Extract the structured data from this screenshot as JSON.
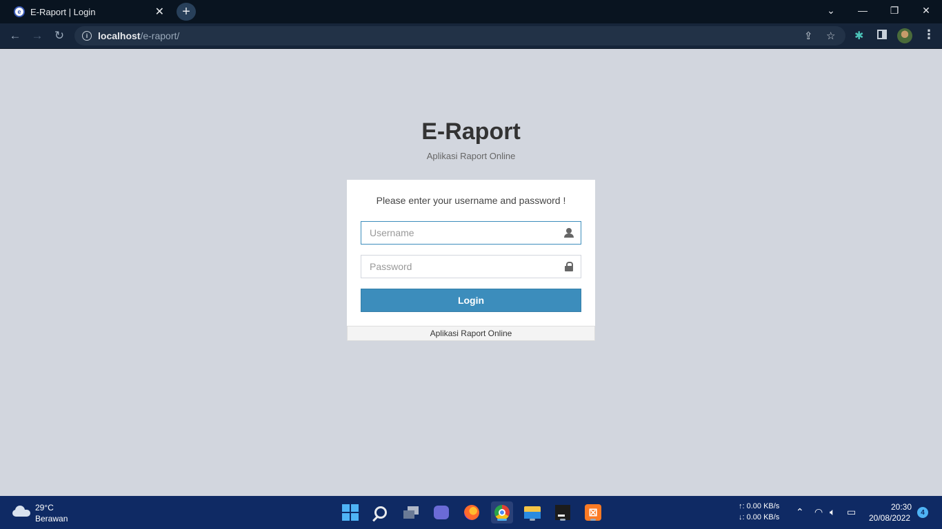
{
  "browser": {
    "tab_title": "E-Raport | Login",
    "new_tab": "+",
    "url_host": "localhost",
    "url_path": "/e-raport/",
    "window_controls": {
      "dropdown": "⌄",
      "minimize": "—",
      "restore": "❐",
      "close": "✕"
    }
  },
  "page": {
    "brand": "E-Raport",
    "subtitle": "Aplikasi Raport Online",
    "login_message": "Please enter your username and password !",
    "username_placeholder": "Username",
    "password_placeholder": "Password",
    "login_button": "Login",
    "footer": "Aplikasi Raport Online",
    "accent_color": "#3c8dbc"
  },
  "taskbar": {
    "temperature": "29°C",
    "weather": "Berawan",
    "net_up": "↑: 0.00 KB/s",
    "net_down": "↓: 0.00 KB/s",
    "time": "20:30",
    "date": "20/08/2022",
    "notification_count": "4",
    "apps": [
      "start",
      "search",
      "task-view",
      "meet",
      "firefox",
      "chrome",
      "file-explorer",
      "pycharm",
      "xampp"
    ]
  }
}
